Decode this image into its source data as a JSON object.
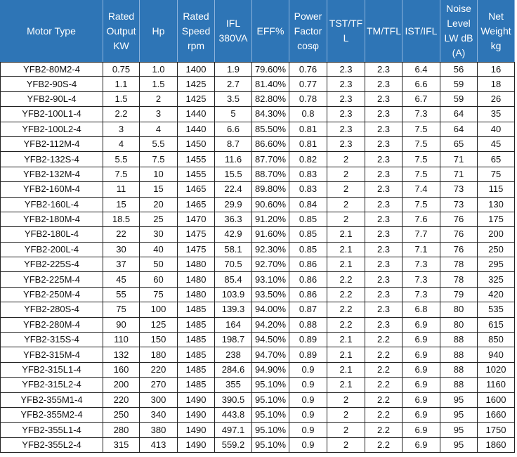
{
  "colors": {
    "header_bg": "#2E75B6",
    "header_text": "#FFFFFF",
    "header_divider": "#8DB3DC",
    "grid": "#222222",
    "cell_text": "#111111"
  },
  "chart_data": {
    "type": "table",
    "columns": [
      "Motor Type",
      "Rated Output KW",
      "Hp",
      "Rated Speed rpm",
      "IFL 380VA",
      "EFF%",
      "Power Factor cosφ",
      "TST/TFL",
      "TM/TFL",
      "IST/IFL",
      "Noise Level LW dB (A)",
      "Net Weight kg"
    ],
    "rows": [
      [
        "YFB2-80M2-4",
        "0.75",
        "1.0",
        "1400",
        "1.9",
        "79.60%",
        "0.76",
        "2.3",
        "2.3",
        "6.4",
        "56",
        "16"
      ],
      [
        "YFB2-90S-4",
        "1.1",
        "1.5",
        "1425",
        "2.7",
        "81.40%",
        "0.77",
        "2.3",
        "2.3",
        "6.6",
        "59",
        "18"
      ],
      [
        "YFB2-90L-4",
        "1.5",
        "2",
        "1425",
        "3.5",
        "82.80%",
        "0.78",
        "2.3",
        "2.3",
        "6.7",
        "59",
        "26"
      ],
      [
        "YFB2-100L1-4",
        "2.2",
        "3",
        "1440",
        "5",
        "84.30%",
        "0.8",
        "2.3",
        "2.3",
        "7.3",
        "64",
        "35"
      ],
      [
        "YFB2-100L2-4",
        "3",
        "4",
        "1440",
        "6.6",
        "85.50%",
        "0.81",
        "2.3",
        "2.3",
        "7.5",
        "64",
        "40"
      ],
      [
        "YFB2-112M-4",
        "4",
        "5.5",
        "1450",
        "8.7",
        "86.60%",
        "0.81",
        "2.3",
        "2.3",
        "7.5",
        "65",
        "45"
      ],
      [
        "YFB2-132S-4",
        "5.5",
        "7.5",
        "1455",
        "11.6",
        "87.70%",
        "0.82",
        "2",
        "2.3",
        "7.5",
        "71",
        "65"
      ],
      [
        "YFB2-132M-4",
        "7.5",
        "10",
        "1455",
        "15.5",
        "88.70%",
        "0.83",
        "2",
        "2.3",
        "7.5",
        "71",
        "75"
      ],
      [
        "YFB2-160M-4",
        "11",
        "15",
        "1465",
        "22.4",
        "89.80%",
        "0.83",
        "2",
        "2.3",
        "7.4",
        "73",
        "115"
      ],
      [
        "YFB2-160L-4",
        "15",
        "20",
        "1465",
        "29.9",
        "90.60%",
        "0.84",
        "2",
        "2.3",
        "7.5",
        "73",
        "130"
      ],
      [
        "YFB2-180M-4",
        "18.5",
        "25",
        "1470",
        "36.3",
        "91.20%",
        "0.85",
        "2",
        "2.3",
        "7.6",
        "76",
        "175"
      ],
      [
        "YFB2-180L-4",
        "22",
        "30",
        "1475",
        "42.9",
        "91.60%",
        "0.85",
        "2.1",
        "2.3",
        "7.7",
        "76",
        "200"
      ],
      [
        "YFB2-200L-4",
        "30",
        "40",
        "1475",
        "58.1",
        "92.30%",
        "0.85",
        "2.1",
        "2.3",
        "7.1",
        "76",
        "250"
      ],
      [
        "YFB2-225S-4",
        "37",
        "50",
        "1480",
        "70.5",
        "92.70%",
        "0.86",
        "2.1",
        "2.3",
        "7.3",
        "78",
        "295"
      ],
      [
        "YFB2-225M-4",
        "45",
        "60",
        "1480",
        "85.4",
        "93.10%",
        "0.86",
        "2.2",
        "2.3",
        "7.3",
        "78",
        "325"
      ],
      [
        "YFB2-250M-4",
        "55",
        "75",
        "1480",
        "103.9",
        "93.50%",
        "0.86",
        "2.2",
        "2.3",
        "7.3",
        "79",
        "420"
      ],
      [
        "YFB2-280S-4",
        "75",
        "100",
        "1485",
        "139.3",
        "94.00%",
        "0.87",
        "2.2",
        "2.3",
        "6.8",
        "80",
        "535"
      ],
      [
        "YFB2-280M-4",
        "90",
        "125",
        "1485",
        "164",
        "94.20%",
        "0.88",
        "2.2",
        "2.3",
        "6.9",
        "80",
        "615"
      ],
      [
        "YFB2-315S-4",
        "110",
        "150",
        "1485",
        "198.7",
        "94.50%",
        "0.89",
        "2.1",
        "2.2",
        "6.9",
        "88",
        "850"
      ],
      [
        "YFB2-315M-4",
        "132",
        "180",
        "1485",
        "238",
        "94.70%",
        "0.89",
        "2.1",
        "2.2",
        "6.9",
        "88",
        "940"
      ],
      [
        "YFB2-315L1-4",
        "160",
        "220",
        "1485",
        "284.6",
        "94.90%",
        "0.9",
        "2.1",
        "2.2",
        "6.9",
        "88",
        "1020"
      ],
      [
        "YFB2-315L2-4",
        "200",
        "270",
        "1485",
        "355",
        "95.10%",
        "0.9",
        "2.1",
        "2.2",
        "6.9",
        "88",
        "1160"
      ],
      [
        "YFB2-355M1-4",
        "220",
        "300",
        "1490",
        "390.5",
        "95.10%",
        "0.9",
        "2",
        "2.2",
        "6.9",
        "95",
        "1600"
      ],
      [
        "YFB2-355M2-4",
        "250",
        "340",
        "1490",
        "443.8",
        "95.10%",
        "0.9",
        "2",
        "2.2",
        "6.9",
        "95",
        "1660"
      ],
      [
        "YFB2-355L1-4",
        "280",
        "380",
        "1490",
        "497.1",
        "95.10%",
        "0.9",
        "2",
        "2.2",
        "6.9",
        "95",
        "1750"
      ],
      [
        "YFB2-355L2-4",
        "315",
        "413",
        "1490",
        "559.2",
        "95.10%",
        "0.9",
        "2",
        "2.2",
        "6.9",
        "95",
        "1860"
      ]
    ]
  }
}
